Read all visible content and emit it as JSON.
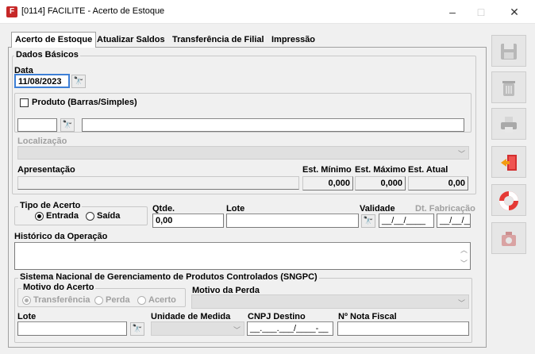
{
  "window": {
    "icon_letter": "F",
    "title": "[0114] FACILITE - Acerto de Estoque",
    "minimize": "–",
    "maximize": "□",
    "close": "✕"
  },
  "tabs": [
    "Acerto de Estoque",
    "Atualizar Saldos",
    "Transferência de Filial",
    "Impressão"
  ],
  "dados_basicos": {
    "title": "Dados Básicos",
    "data_label": "Data",
    "data_value": "11/08/2023",
    "produto_label": "Produto (Barras/Simples)",
    "localizacao_label": "Localização",
    "apresentacao_label": "Apresentação",
    "est_minimo_label": "Est. Mínimo",
    "est_maximo_label": "Est. Máximo",
    "est_atual_label": "Est. Atual",
    "est_minimo": "0,000",
    "est_maximo": "0,000",
    "est_atual": "0,00"
  },
  "tipo_acerto": {
    "title": "Tipo de Acerto",
    "entrada": "Entrada",
    "saida": "Saída"
  },
  "qtde_label": "Qtde.",
  "qtde_value": "0,00",
  "lote_label": "Lote",
  "validade_label": "Validade",
  "validade_value": "__/__/____",
  "dt_fabricacao_label": "Dt. Fabricação",
  "dt_fabricacao_value": "__/__/____",
  "historico_label": "Histórico da Operação",
  "sngpc": {
    "title": "Sistema Nacional de Gerenciamento de Produtos Controlados (SNGPC)",
    "motivo_acerto_label": "Motivo do Acerto",
    "transferencia": "Transferência",
    "perda": "Perda",
    "acerto": "Acerto",
    "motivo_perda_label": "Motivo da Perda",
    "lote_label": "Lote",
    "unidade_label": "Unidade de Medida",
    "cnpj_label": "CNPJ Destino",
    "cnpj_value": "__.___.___/____-__",
    "nota_label": "Nº Nota Fiscal"
  },
  "icons": {
    "save": "save-icon",
    "trash": "trash-icon",
    "print": "printer-icon",
    "exit": "exit-door-icon",
    "help": "lifebuoy-icon",
    "tools": "tools-icon"
  }
}
